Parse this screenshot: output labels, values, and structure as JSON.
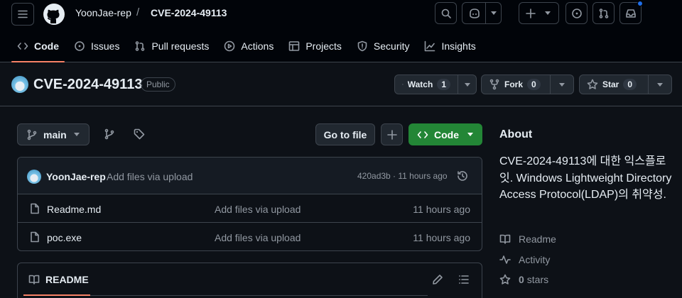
{
  "header": {
    "owner": "YoonJae-rep",
    "separator": "/",
    "repo": "CVE-2024-49113"
  },
  "nav": {
    "tabs": [
      {
        "label": "Code",
        "icon": "code-icon",
        "active": true
      },
      {
        "label": "Issues",
        "icon": "issue-icon"
      },
      {
        "label": "Pull requests",
        "icon": "pull-request-icon"
      },
      {
        "label": "Actions",
        "icon": "play-icon"
      },
      {
        "label": "Projects",
        "icon": "table-icon"
      },
      {
        "label": "Security",
        "icon": "shield-icon"
      },
      {
        "label": "Insights",
        "icon": "graph-icon"
      }
    ]
  },
  "repo": {
    "name": "CVE-2024-49113",
    "visibility": "Public",
    "watch_label": "Watch",
    "watch_count": "1",
    "fork_label": "Fork",
    "fork_count": "0",
    "star_label": "Star",
    "star_count": "0"
  },
  "toolbar": {
    "branch": "main",
    "goto_file": "Go to file",
    "code_label": "Code"
  },
  "latest_commit": {
    "author": "YoonJae-rep",
    "message": "Add files via upload",
    "hash_time": "420ad3b · 11 hours ago"
  },
  "files": [
    {
      "name": "Readme.md",
      "message": "Add files via upload",
      "time": "11 hours ago"
    },
    {
      "name": "poc.exe",
      "message": "Add files via upload",
      "time": "11 hours ago"
    }
  ],
  "readme": {
    "label": "README"
  },
  "about": {
    "title": "About",
    "description": "CVE-2024-49113에 대한 익스플로잇. Windows Lightweight Directory Access Protocol(LDAP)의 취약성.",
    "readme_link": "Readme",
    "activity_link": "Activity",
    "stars_count": "0",
    "stars_label": "stars"
  },
  "colors": {
    "background": "#0d1117",
    "header_bg": "#010409",
    "accent_tab": "#f78166",
    "code_button": "#238636",
    "notification_dot": "#1f6feb"
  }
}
